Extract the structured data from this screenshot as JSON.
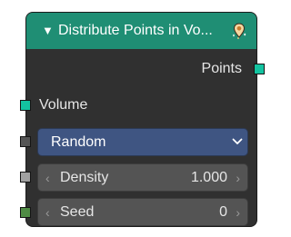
{
  "node": {
    "title": "Distribute Points in Vo...",
    "collapse_icon": "triangle-down-icon",
    "title_icon": "pin-sparkle-icon",
    "header_color": "#1f8e74",
    "body_color": "#303030",
    "outputs": [
      {
        "label": "Points",
        "socket_color": "#13c3a0"
      }
    ],
    "inputs": {
      "volume": {
        "label": "Volume",
        "socket_color": "#13c3a0"
      },
      "mode": {
        "value": "Random",
        "socket_color": "#555555",
        "chevron_icon": "chevron-down-icon",
        "color": "#3f5582"
      },
      "density": {
        "label": "Density",
        "value": "1.000",
        "socket_color": "#a1a1a1",
        "decrement": "‹",
        "increment": "›"
      },
      "seed": {
        "label": "Seed",
        "value": "0",
        "socket_color": "#4f8c44",
        "decrement": "‹",
        "increment": "›"
      }
    }
  }
}
